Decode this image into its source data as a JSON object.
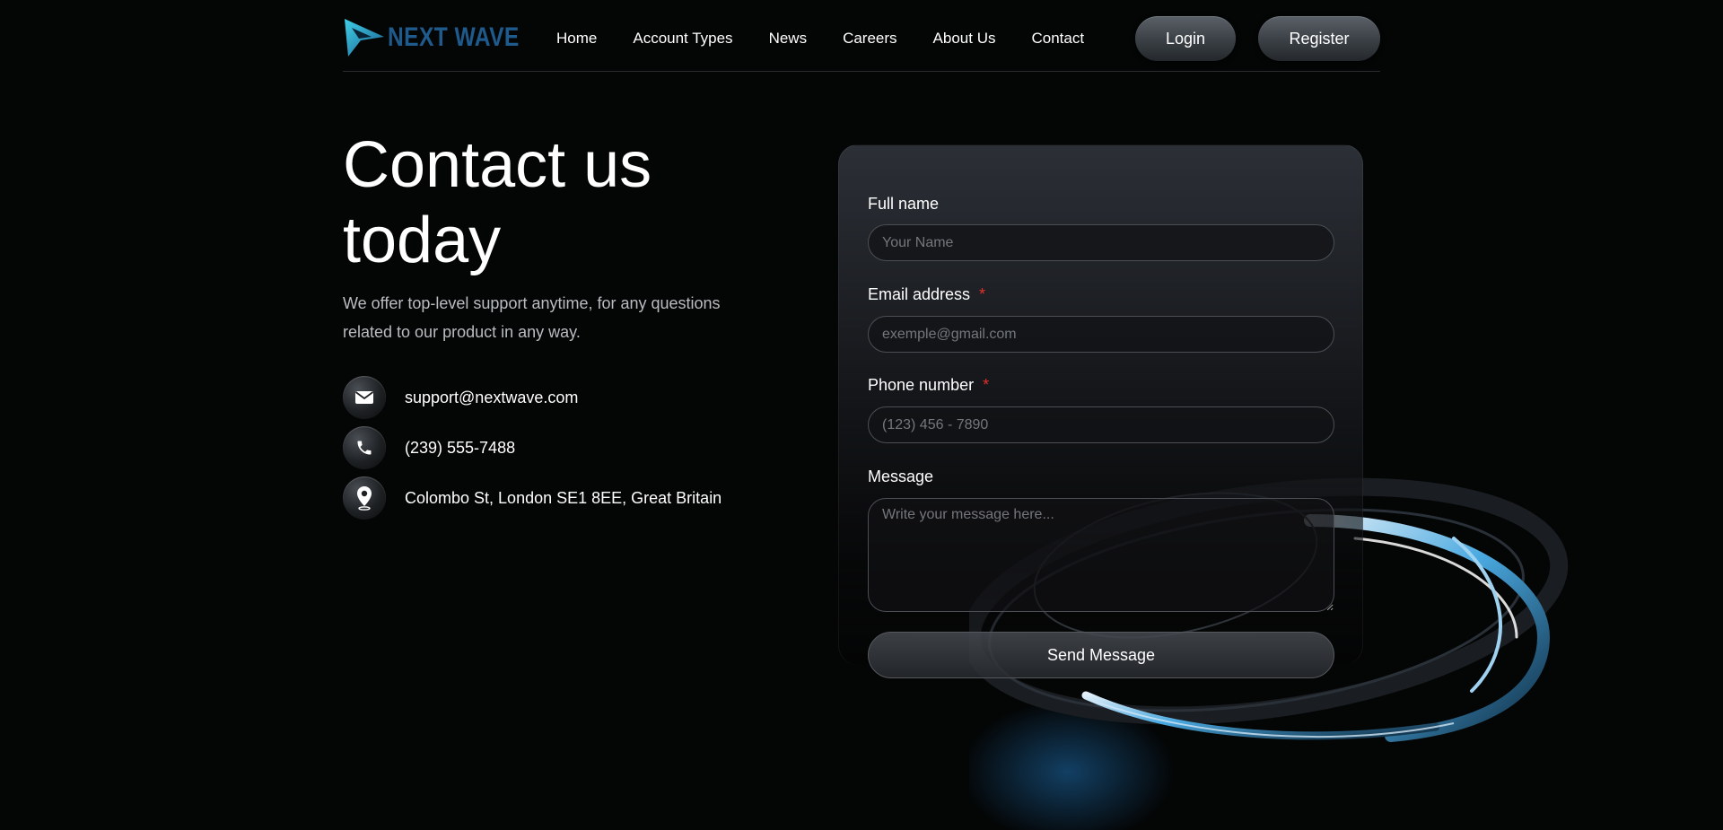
{
  "brand": {
    "name": "NEXT WAVE",
    "accent": "#1f5a8c",
    "logo_icon": "arrow-logo-icon"
  },
  "nav": {
    "items": [
      {
        "label": "Home"
      },
      {
        "label": "Account Types"
      },
      {
        "label": "News"
      },
      {
        "label": "Careers"
      },
      {
        "label": "About Us"
      },
      {
        "label": "Contact"
      }
    ],
    "login_label": "Login",
    "register_label": "Register"
  },
  "hero": {
    "title_line1": "Contact us",
    "title_line2": "today",
    "subtitle": "We offer top-level support anytime, for any questions related to our product in any way."
  },
  "contacts": [
    {
      "icon": "mail-icon",
      "text": "support@nextwave.com"
    },
    {
      "icon": "phone-icon",
      "text": "(239) 555-7488"
    },
    {
      "icon": "location-pin-icon",
      "text": "Colombo St, London SE1 8EE, Great Britain"
    }
  ],
  "form": {
    "full_name": {
      "label": "Full name",
      "placeholder": "Your Name",
      "value": ""
    },
    "email": {
      "label": "Email address",
      "required_mark": "*",
      "placeholder": "exemple@gmail.com",
      "value": ""
    },
    "phone": {
      "label": "Phone number",
      "required_mark": "*",
      "placeholder": "(123) 456 - 7890",
      "value": ""
    },
    "message": {
      "label": "Message",
      "placeholder": "Write your message here...",
      "value": ""
    },
    "submit_label": "Send Message",
    "required_color": "#e0322c"
  }
}
